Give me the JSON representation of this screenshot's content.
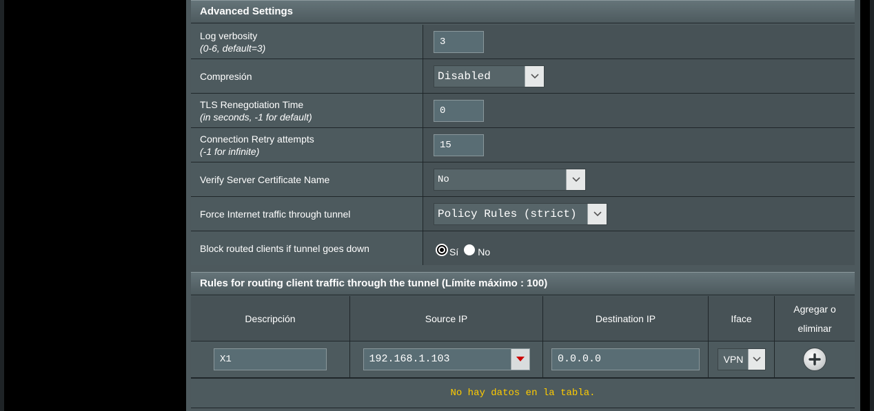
{
  "advanced": {
    "title": "Advanced Settings",
    "log_verbosity": {
      "label": "Log verbosity",
      "hint": "(0-6, default=3)",
      "value": "3"
    },
    "compression": {
      "label": "Compresión",
      "value": "Disabled"
    },
    "tls_reneg": {
      "label": "TLS Renegotiation Time",
      "hint": "(in seconds, -1 for default)",
      "value": "0"
    },
    "retry": {
      "label": "Connection Retry attempts",
      "hint": "(-1 for infinite)",
      "value": "15"
    },
    "verify_cert": {
      "label": "Verify Server Certificate Name",
      "value": "No"
    },
    "force_traffic": {
      "label": "Force Internet traffic through tunnel",
      "value": "Policy Rules (strict)"
    },
    "block_routed": {
      "label": "Block routed clients if tunnel goes down",
      "option_yes": "Sí",
      "option_no": "No",
      "selected": "Sí"
    }
  },
  "rules": {
    "title": "Rules for routing client traffic through the tunnel (Límite máximo : 100)",
    "columns": {
      "description": "Descripción",
      "source_ip": "Source IP",
      "destination_ip": "Destination IP",
      "iface": "Iface",
      "add_remove_line1": "Agregar o",
      "add_remove_line2": "eliminar"
    },
    "new_row": {
      "description": "X1",
      "source_ip": "192.168.1.103",
      "destination_ip": "0.0.0.0",
      "iface": "VPN"
    },
    "empty_message": "No hay datos en la tabla."
  },
  "colors": {
    "panel": "#4d595d",
    "accent_text": "#ffcc00",
    "dropdown_accent": "#cc0000"
  },
  "icons": {
    "dropdown": "chevron-down-icon",
    "source_dropdown": "triangle-down-icon",
    "add": "plus-circle-icon"
  }
}
